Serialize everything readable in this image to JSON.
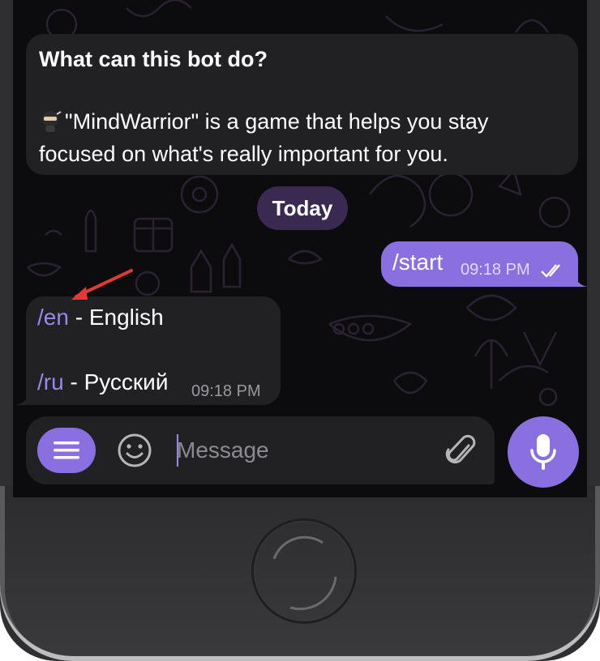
{
  "chat": {
    "info": {
      "title": "What can this bot do?",
      "body": "\"MindWarrior\" is a game that helps you stay focused on what's really important for you.",
      "body_icon": "ninja-emoji"
    },
    "date_separator": "Today",
    "outgoing": {
      "text": "/start",
      "time": "09:18 PM",
      "status_icon": "double-check-icon"
    },
    "incoming": {
      "lines": [
        {
          "command": "/en",
          "label": " - English"
        },
        {
          "command": "/ru",
          "label": " - Русский"
        }
      ],
      "time": "09:18 PM"
    }
  },
  "composer": {
    "menu_icon": "menu-icon",
    "emoji_icon": "smile-icon",
    "placeholder": "Message",
    "attach_icon": "paperclip-icon",
    "send_icon": "microphone-icon"
  },
  "colors": {
    "accent": "#8a6fe0",
    "bubble": "#212123",
    "background": "#0c0c0e",
    "link": "#9c86f0",
    "annotation_arrow": "#e53935"
  }
}
